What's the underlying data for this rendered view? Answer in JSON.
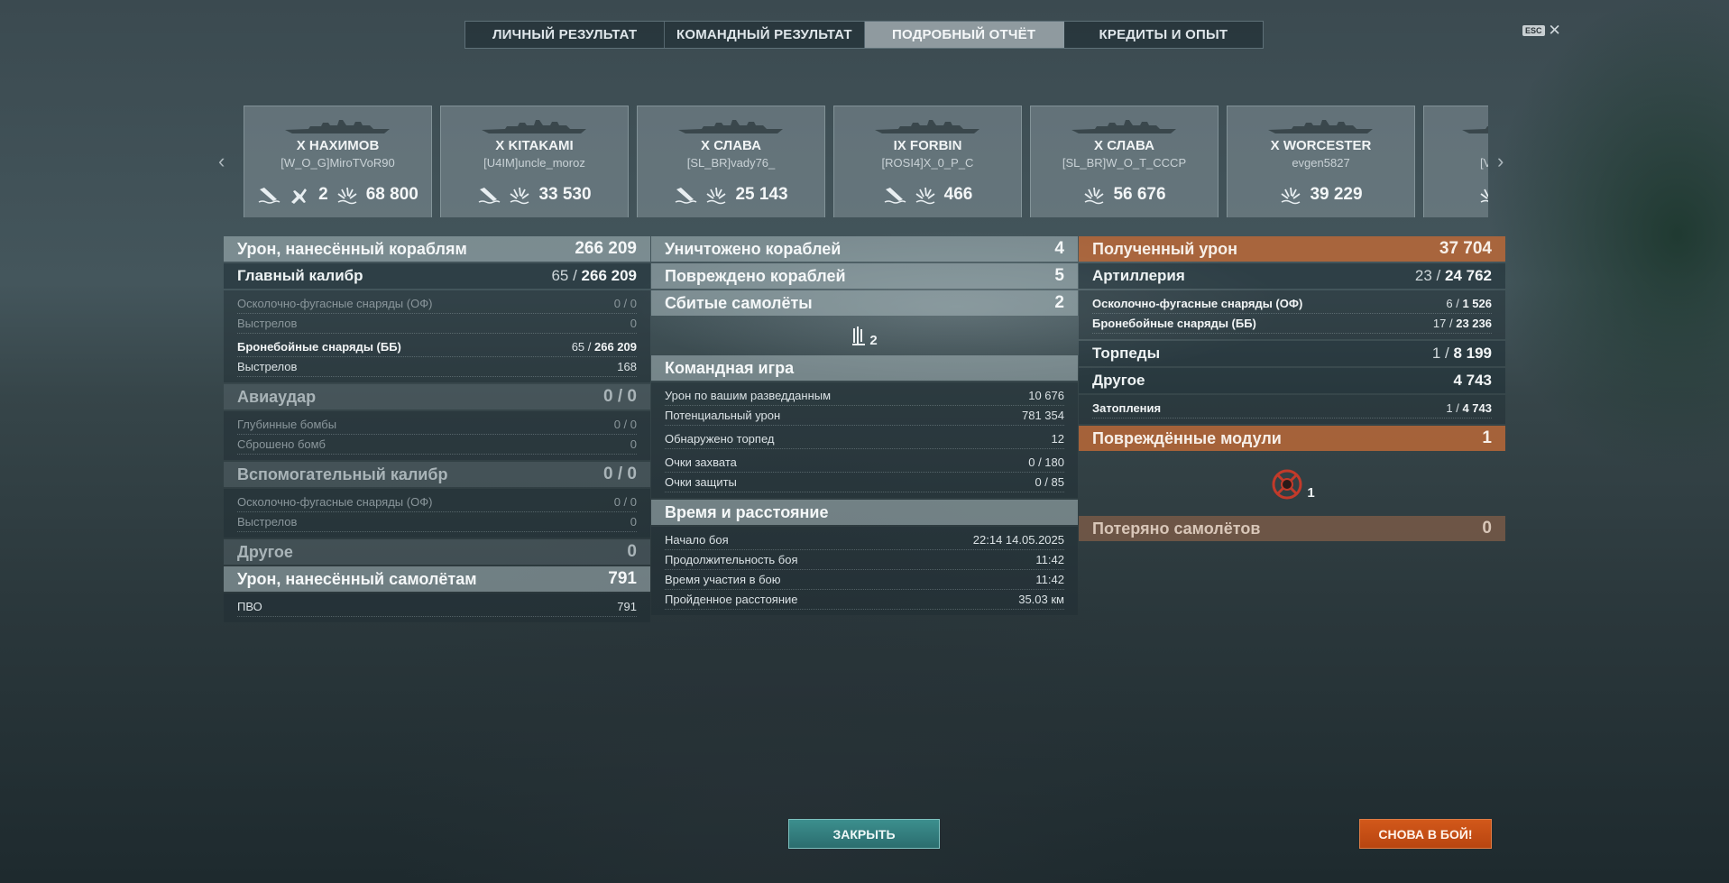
{
  "tabs": [
    {
      "label": "ЛИЧНЫЙ РЕЗУЛЬТАТ"
    },
    {
      "label": "КОМАНДНЫЙ РЕЗУЛЬТАТ"
    },
    {
      "label": "ПОДРОБНЫЙ ОТЧЁТ",
      "active": true
    },
    {
      "label": "КРЕДИТЫ И ОПЫТ"
    }
  ],
  "esc": {
    "key": "ESC",
    "close": "✕"
  },
  "ships": [
    {
      "tier_name": "X НАХИМОВ",
      "player": "[W_O_G]MiroTVoR90",
      "planes": "2",
      "damage": "68 800"
    },
    {
      "tier_name": "X KITAKAMI",
      "player": "[U4IM]uncle_moroz",
      "damage": "33 530"
    },
    {
      "tier_name": "X СЛАВА",
      "player": "[SL_BR]vady76_",
      "damage": "25 143"
    },
    {
      "tier_name": "IX FORBIN",
      "player": "[ROSI4]X_0_P_C",
      "damage": "466"
    },
    {
      "tier_name": "X СЛАВА",
      "player": "[SL_BR]W_O_T_CCCP",
      "damage": "56 676"
    },
    {
      "tier_name": "X WORCESTER",
      "player": "evgen5827",
      "damage": "39 229"
    },
    {
      "player": "[V"
    }
  ],
  "left": {
    "ship_damage": {
      "label": "Урон, нанесённый кораблям",
      "value": "266 209"
    },
    "main_battery": {
      "label": "Главный калибр",
      "hits": "65",
      "dmg": "266 209"
    },
    "he_shells": {
      "label": "Осколочно-фугасные снаряды (ОФ)",
      "value": "0 / 0"
    },
    "he_shots": {
      "label": "Выстрелов",
      "value": "0"
    },
    "ap_shells": {
      "label": "Бронебойные снаряды (ББ)",
      "hits": "65",
      "dmg": "266 209"
    },
    "ap_shots": {
      "label": "Выстрелов",
      "value": "168"
    },
    "airstrike": {
      "label": "Авиаудар",
      "value": "0 / 0"
    },
    "depth_charges": {
      "label": "Глубинные бомбы",
      "value": "0 / 0"
    },
    "bombs_dropped": {
      "label": "Сброшено бомб",
      "value": "0"
    },
    "secondary": {
      "label": "Вспомогательный калибр",
      "value": "0 / 0"
    },
    "sec_he": {
      "label": "Осколочно-фугасные снаряды (ОФ)",
      "value": "0 / 0"
    },
    "sec_shots": {
      "label": "Выстрелов",
      "value": "0"
    },
    "other": {
      "label": "Другое",
      "value": "0"
    },
    "plane_damage": {
      "label": "Урон, нанесённый самолётам",
      "value": "791"
    },
    "aa": {
      "label": "ПВО",
      "value": "791"
    }
  },
  "middle": {
    "destroyed": {
      "label": "Уничтожено кораблей",
      "value": "4"
    },
    "damaged": {
      "label": "Повреждено кораблей",
      "value": "5"
    },
    "planes_shot": {
      "label": "Сбитые самолёты",
      "value": "2"
    },
    "planes_icon_count": "2",
    "team": {
      "label": "Командная игра"
    },
    "spotting_damage": {
      "label": "Урон по вашим разведданным",
      "value": "10 676"
    },
    "potential_damage": {
      "label": "Потенциальный урон",
      "value": "781 354"
    },
    "torpedoes_spotted": {
      "label": "Обнаружено торпед",
      "value": "12"
    },
    "capture_points": {
      "label": "Очки захвата",
      "value": "0 / 180"
    },
    "defense_points": {
      "label": "Очки защиты",
      "value": "0 / 85"
    },
    "time": {
      "label": "Время и расстояние"
    },
    "battle_start": {
      "label": "Начало боя",
      "value": "22:14  14.05.2025"
    },
    "battle_duration": {
      "label": "Продолжительность боя",
      "value": "11:42"
    },
    "participation": {
      "label": "Время участия в бою",
      "value": "11:42"
    },
    "distance": {
      "label": "Пройденное расстояние",
      "value": "35.03 км"
    }
  },
  "right": {
    "received": {
      "label": "Полученный урон",
      "value": "37 704"
    },
    "artillery": {
      "label": "Артиллерия",
      "hits": "23",
      "dmg": "24 762"
    },
    "r_he": {
      "label": "Осколочно-фугасные снаряды (ОФ)",
      "hits": "6",
      "dmg": "1 526"
    },
    "r_ap": {
      "label": "Бронебойные снаряды (ББ)",
      "hits": "17",
      "dmg": "23 236"
    },
    "torpedoes": {
      "label": "Торпеды",
      "hits": "1",
      "dmg": "8 199"
    },
    "other": {
      "label": "Другое",
      "value": "4 743"
    },
    "flooding": {
      "label": "Затопления",
      "hits": "1",
      "dmg": "4 743"
    },
    "modules": {
      "label": "Повреждённые модули",
      "value": "1"
    },
    "module_count": "1",
    "planes_lost": {
      "label": "Потеряно самолётов",
      "value": "0"
    }
  },
  "buttons": {
    "close": "ЗАКРЫТЬ",
    "battle": "СНОВА В БОЙ!"
  },
  "colors": {
    "accent_orange": "#c7692f",
    "close_teal": "#35807f",
    "battle_orange": "#c94e14"
  }
}
